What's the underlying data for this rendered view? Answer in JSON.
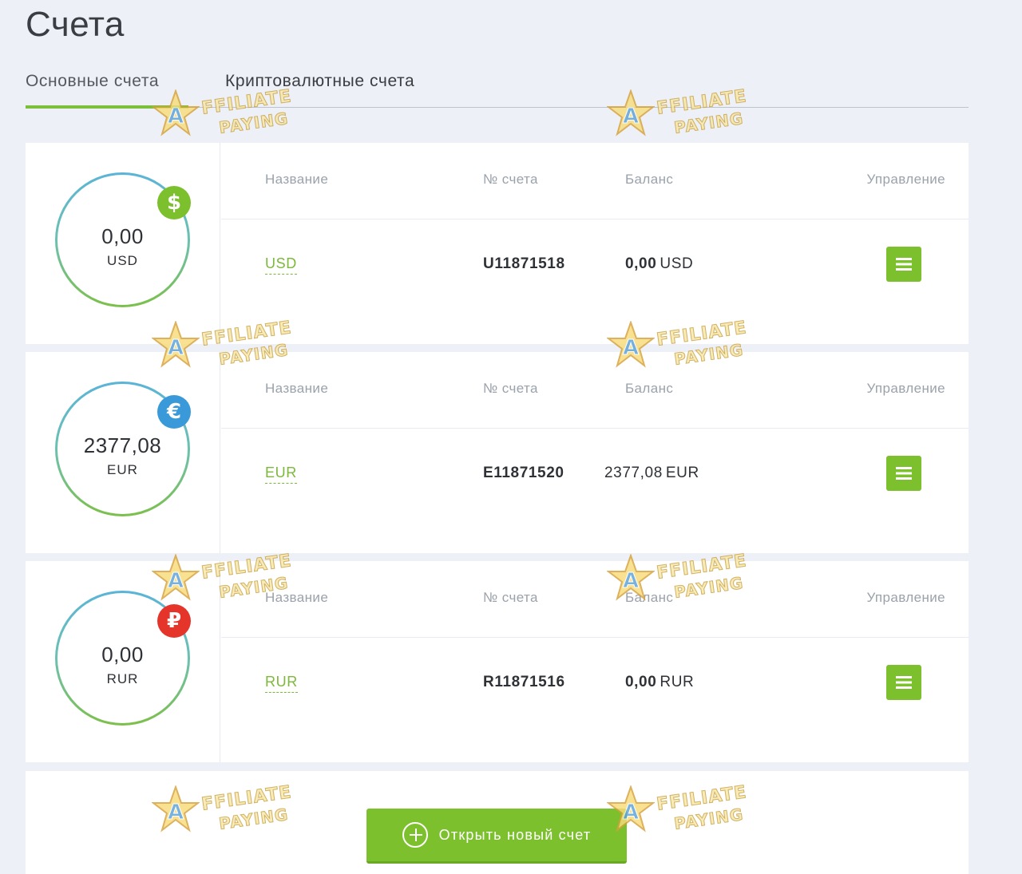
{
  "page": {
    "title": "Счета"
  },
  "tabs": [
    {
      "label": "Основные счета",
      "active": true
    },
    {
      "label": "Криптовалютные счета",
      "active": false
    }
  ],
  "table_headers": {
    "name": "Название",
    "number": "№ счета",
    "balance": "Баланс",
    "control": "Управление"
  },
  "accounts": [
    {
      "circle_amount": "0,00",
      "circle_currency": "USD",
      "badge_symbol": "$",
      "badge_icon": "dollar-icon",
      "badge_color": "#7cc02e",
      "name": "USD",
      "number": "U11871518",
      "balance_amount": "0,00",
      "balance_currency": "USD"
    },
    {
      "circle_amount": "2377,08",
      "circle_currency": "EUR",
      "badge_symbol": "€",
      "badge_icon": "euro-icon",
      "badge_color": "#3a9ad9",
      "name": "EUR",
      "number": "E11871520",
      "balance_amount": "2377,08",
      "balance_currency": "EUR"
    },
    {
      "circle_amount": "0,00",
      "circle_currency": "RUR",
      "badge_symbol": "₽",
      "badge_icon": "ruble-icon",
      "badge_color": "#e5352b",
      "name": "RUR",
      "number": "R11871516",
      "balance_amount": "0,00",
      "balance_currency": "RUR"
    }
  ],
  "actions": {
    "open_account_label": "Открыть новый счет"
  },
  "watermark": {
    "line1": "FFILIATE",
    "line2": "PAYING",
    "letter": "A"
  },
  "colors": {
    "accent": "#7cc02e",
    "background": "#edf1f7"
  }
}
